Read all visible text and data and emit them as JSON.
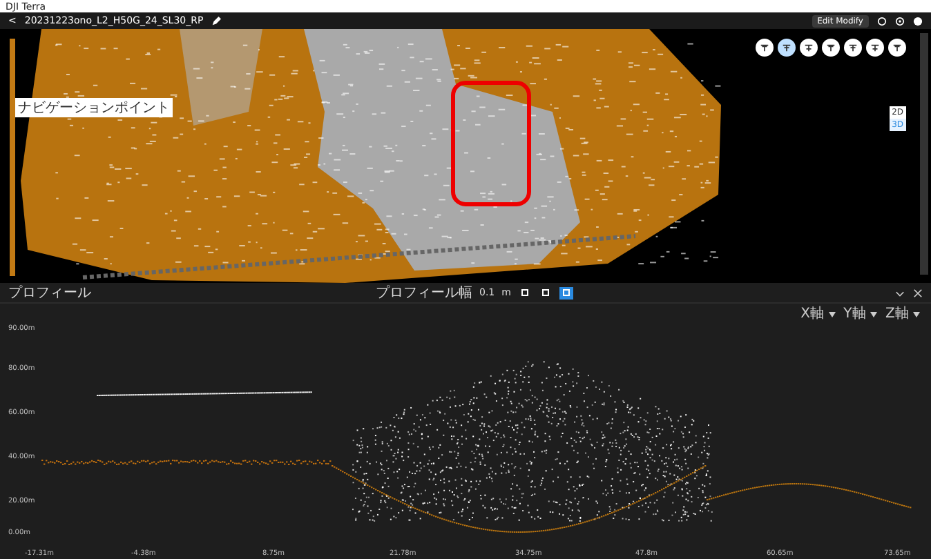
{
  "window": {
    "title": "DJI Terra"
  },
  "header": {
    "back": "<",
    "project": "20231223ono_L2_H50G_24_SL30_RP",
    "action": "Edit Modify"
  },
  "map": {
    "tools": [
      {
        "selected": false
      },
      {
        "selected": true
      },
      {
        "selected": false
      },
      {
        "selected": false
      },
      {
        "selected": false
      },
      {
        "selected": false
      },
      {
        "selected": false
      }
    ],
    "view_modes": [
      {
        "label": "2D",
        "selected": false
      },
      {
        "label": "3D",
        "selected": true
      }
    ],
    "height_bar": {
      "label": "ナビゲーションポイント"
    }
  },
  "profile": {
    "title": "プロフィール",
    "width_label": "プロフィール幅",
    "width_value": "0.1",
    "width_unit": "m",
    "view_buttons": [
      {
        "selected": false
      },
      {
        "selected": false
      },
      {
        "selected": true
      }
    ],
    "axis_menus": [
      "X軸",
      "Y軸",
      "Z軸"
    ],
    "y_labels": [
      "90.00m",
      "80.00m",
      "60.00m",
      "40.00m",
      "20.00m",
      "0.00m"
    ],
    "x_labels": [
      "-17.31m",
      "-4.38m",
      "8.75m",
      "21.78m",
      "34.75m",
      "47.8m",
      "60.65m",
      "73.65m"
    ]
  }
}
